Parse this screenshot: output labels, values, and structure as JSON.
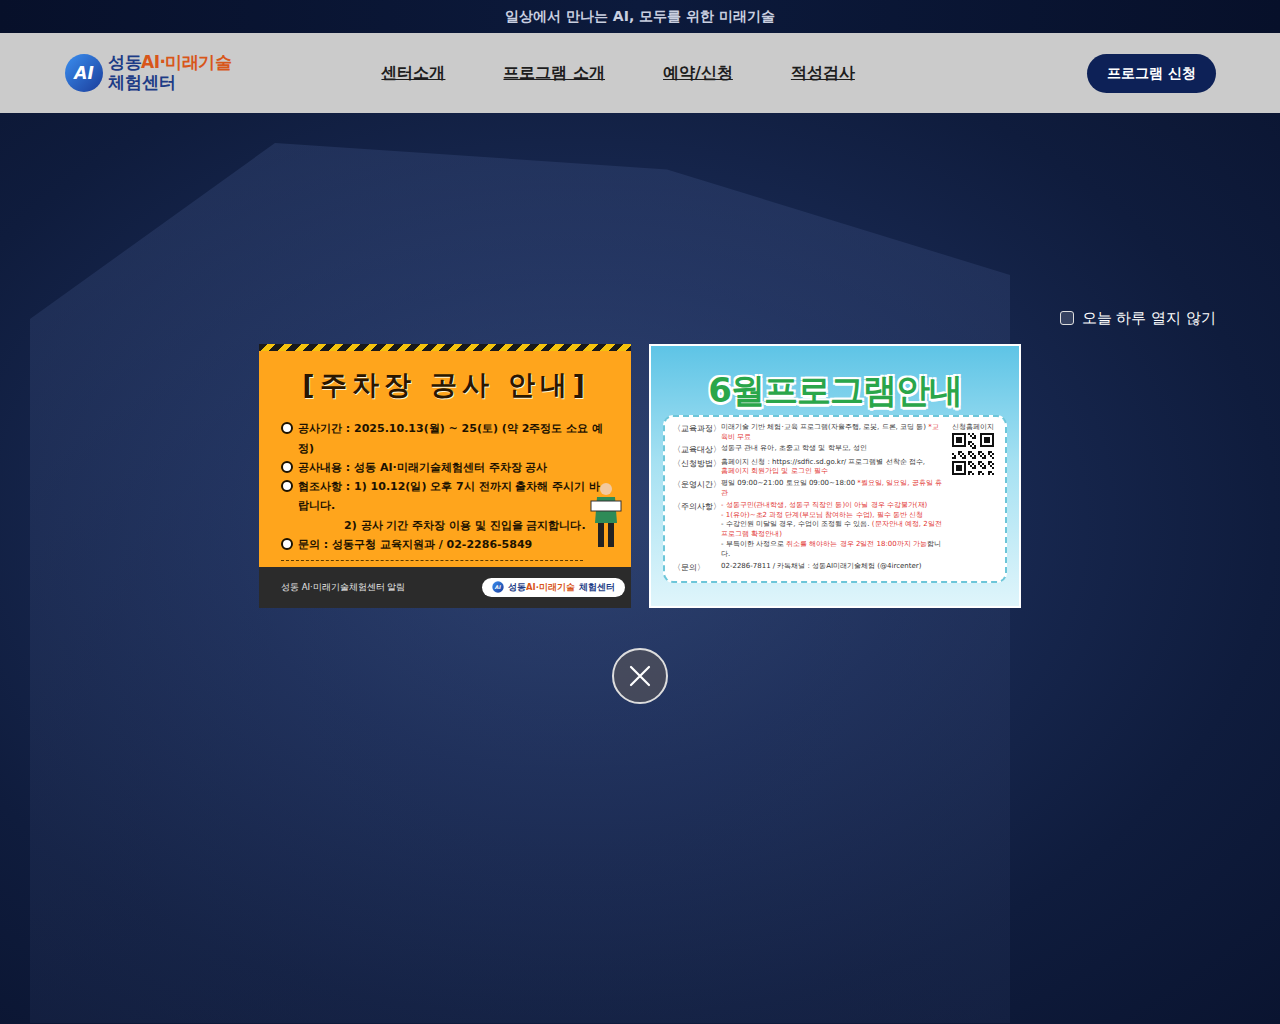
{
  "top_banner": {
    "text": "일상에서 만나는 AI, 모두를 위한 미래기술"
  },
  "header": {
    "logo": {
      "mark": "AI",
      "name_a": "성동",
      "name_b": "AI·미래기술",
      "name_c": "체험센터"
    },
    "nav": [
      {
        "label": "센터소개",
        "selected": false
      },
      {
        "label": "프로그램 소개",
        "selected": false
      },
      {
        "label": "예약/신청",
        "selected": false
      },
      {
        "label": "적성검사",
        "selected": false
      }
    ],
    "cta": "프로그램 신청"
  },
  "popup": {
    "dont_show_today": {
      "label": "오늘 하루 열지 않기",
      "checked": false
    },
    "notices": [
      {
        "kind": "parking",
        "title": "[주차장 공사 안내]",
        "items": [
          {
            "lines": [
              "공사기간 : 2025.10.13(월) ~ 25(토) (약 2주정도 소요 예정)"
            ]
          },
          {
            "lines": [
              "공사내용 : 성동 AI·미래기술체험센터 주차장 공사"
            ]
          },
          {
            "lines": [
              "협조사항 : 1) 10.12(일) 오후 7시 전까지 출차해 주시기 바랍니다.",
              "2) 공사 기간 주차장 이용 및 진입을 금지합니다."
            ]
          },
          {
            "lines": [
              "문의 : 성동구청 교육지원과 / 02-2286-5849"
            ]
          }
        ],
        "footer": "성동 AI·미래기술체험센터 알림",
        "badge": {
          "mark": "AI",
          "name_a": "성동",
          "name_b": "AI·미래기술",
          "name_c": "체험센터"
        }
      },
      {
        "kind": "program",
        "title": "6월프로그램안내",
        "rows": [
          {
            "label": "〈교육과정〉",
            "lines": [
              [
                {
                  "text": "미래기술 기반 체험·교육 프로그램(자율주행, 로봇, 드론, 코딩 등) ",
                  "emphasis": false
                },
                {
                  "text": "*교육비 무료",
                  "emphasis": true
                }
              ]
            ]
          },
          {
            "label": "〈교육대상〉",
            "lines": [
              [
                {
                  "text": "성동구 관내 유아, 초중고 학생 및 학부모, 성인",
                  "emphasis": false
                }
              ]
            ]
          },
          {
            "label": "〈신청방법〉",
            "lines": [
              [
                {
                  "text": "홈페이지 신청 : https://sdfic.sd.go.kr/ 프로그램별 선착순 접수,",
                  "emphasis": false
                }
              ],
              [
                {
                  "text": "홈페이지 회원가입 및 로그인 필수",
                  "emphasis": true
                }
              ]
            ]
          },
          {
            "label": "〈운영시간〉",
            "lines": [
              [
                {
                  "text": "평일 09:00~21:00 토요일 09:00~18:00 ",
                  "emphasis": false
                },
                {
                  "text": "*월요일, 일요일, 공휴일 휴관",
                  "emphasis": true
                }
              ]
            ]
          },
          {
            "label": "〈주의사항〉",
            "lines": [
              [
                {
                  "text": "- 성동구민(관내학생, 성동구 직장인 등)이 아닐 경우 수강불가(재)",
                  "emphasis": true
                }
              ],
              [
                {
                  "text": "- 1(유아)~초2 과정 단계(부모님 참여하는 수업), ",
                  "emphasis": true
                },
                {
                  "text": "필수 동반 신청",
                  "emphasis": true
                }
              ],
              [
                {
                  "text": "- 수강인원 미달일 경우, 수업이 조정될 수 있음. ",
                  "emphasis": false
                },
                {
                  "text": "(문자안내 예정, 2일전 프로그램 확정안내)",
                  "emphasis": true
                }
              ],
              [
                {
                  "text": "- 부득이한 사정으로 ",
                  "emphasis": false
                },
                {
                  "text": "취소를 해야하는 경우 2일전 18:00까지 가능",
                  "emphasis": true
                },
                {
                  "text": "합니다.",
                  "emphasis": false
                }
              ]
            ]
          },
          {
            "label": "〈문의〉",
            "lines": [
              [
                {
                  "text": "02-2286-7811 / 카톡채널 : 성동AI미래기술체험 (@4ircenter)",
                  "emphasis": false
                }
              ]
            ]
          }
        ],
        "qr_label": "신청홈페이지"
      }
    ]
  }
}
